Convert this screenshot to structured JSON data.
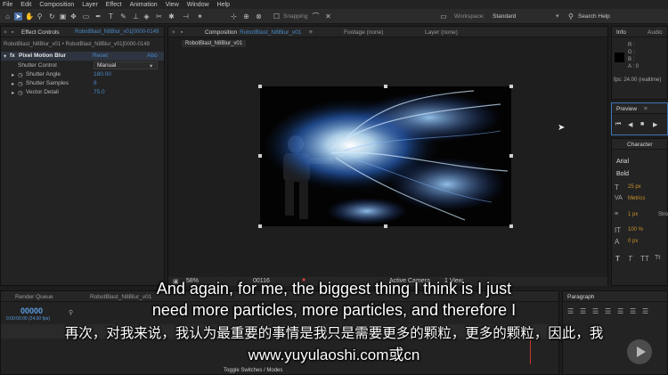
{
  "menu": [
    "File",
    "Edit",
    "Composition",
    "Layer",
    "Effect",
    "Animation",
    "View",
    "Window",
    "Help"
  ],
  "toolbar": {
    "snapping": "Snapping",
    "workspace_label": "Workspace:",
    "workspace_value": "Standard",
    "search_help": "Search Help"
  },
  "effect_controls": {
    "tab": "Effect Controls",
    "tab_layer": "RobotBlast_N8Blur_v01[0000-0149",
    "header": "RobotBlast_N8Blur_v01 • RobotBlast_N8Blur_v01[0000-0149",
    "effect_name": "Pixel Motion Blur",
    "reset": "Reset",
    "about": "Abo",
    "shutter_control_label": "Shutter Control",
    "shutter_control_value": "Manual",
    "params": [
      {
        "label": "Shutter Angle",
        "value": "180.00"
      },
      {
        "label": "Shutter Samples",
        "value": "8"
      },
      {
        "label": "Vector Detail",
        "value": "75.0"
      }
    ]
  },
  "composition": {
    "tab": "Composition",
    "tab_name": "RobotBlast_N8Blur_v01",
    "footage_tab": "Footage (none)",
    "layer_tab": "Layer (none)",
    "comp_tab_label": "RobotBlast_N8Blur_v01",
    "zoom": "58%",
    "timecode": "00116",
    "view": "1 View",
    "camera": "Active Camera"
  },
  "info": {
    "tab": "Info",
    "tab2": "Audio",
    "r": "R :",
    "g": "G :",
    "b": "B :",
    "a": "A : 0",
    "fps": "fps: 24.00 (realtime)"
  },
  "preview": {
    "tab": "Preview"
  },
  "character": {
    "tab": "Character",
    "font": "Arial",
    "style": "Bold",
    "size": "25 px",
    "kerning": "Metrics",
    "stroke": "1 px",
    "stroke_type": "Stro",
    "scale": "100 %",
    "baseline": "0 px"
  },
  "timeline": {
    "render_queue": "Render Queue",
    "comp_tab": "RobotBlast_N8Blur_v01",
    "timecode": "00000",
    "timecode_sub": "0:00:00:00 (24.00 fps)",
    "toggle": "Toggle Switches / Modes"
  },
  "paragraph": {
    "tab": "Paragraph"
  },
  "subtitles": {
    "en_line1": "And again, for me, the biggest thing I think is I just",
    "en_line2": "need more particles, more particles, and therefore I",
    "cn_line": "再次，对我来说，我认为最重要的事情是我只是需要更多的颗粒，更多的颗粒，因此，我",
    "url": "www.yuyulaoshi.com或cn"
  },
  "colors": {
    "accent_blue": "#4a89c7",
    "timecode_blue": "#5b9de0",
    "panel_bg": "#232323"
  }
}
